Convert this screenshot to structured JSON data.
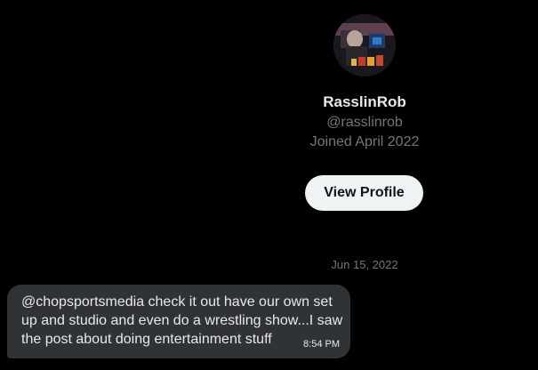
{
  "profile": {
    "name": "RasslinRob",
    "handle": "@rasslinrob",
    "joined": "Joined April 2022",
    "view_profile_label": "View Profile"
  },
  "conversation": {
    "date_separator": "Jun 15, 2022",
    "messages": [
      {
        "text": "@chopsportsmedia check it out have our own set up and studio and even do a wrestling show...I saw the post about doing entertainment stuff",
        "time": "8:54 PM"
      }
    ]
  },
  "colors": {
    "background": "#000000",
    "bubble": "#2f3336",
    "secondary_text": "#71767b",
    "button_bg": "#eff3f4"
  }
}
